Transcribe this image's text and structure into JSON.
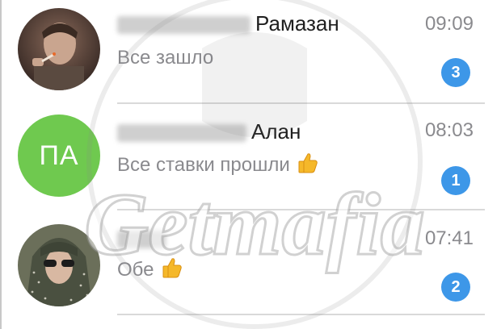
{
  "chats": [
    {
      "name": "Рамазан",
      "message": "Все зашло",
      "time": "09:09",
      "unread": "3",
      "avatar_type": "photo",
      "has_thumb": false
    },
    {
      "name": "Алан",
      "message": "Все ставки прошли",
      "time": "08:03",
      "unread": "1",
      "avatar_type": "initials",
      "initials": "ПА",
      "has_thumb": true
    },
    {
      "name": "",
      "message": "Обе",
      "time": "07:41",
      "unread": "2",
      "avatar_type": "photo",
      "has_thumb": true
    }
  ],
  "watermark": {
    "text": "Getmafia"
  },
  "colors": {
    "badge": "#3d97e8",
    "initials_avatar": "#6fc94f",
    "name_text": "#1f1f1f",
    "secondary_text": "#8a8a8e",
    "divider": "#d9d9d9"
  },
  "icons": {
    "thumbs_up": "thumbs-up-icon"
  }
}
